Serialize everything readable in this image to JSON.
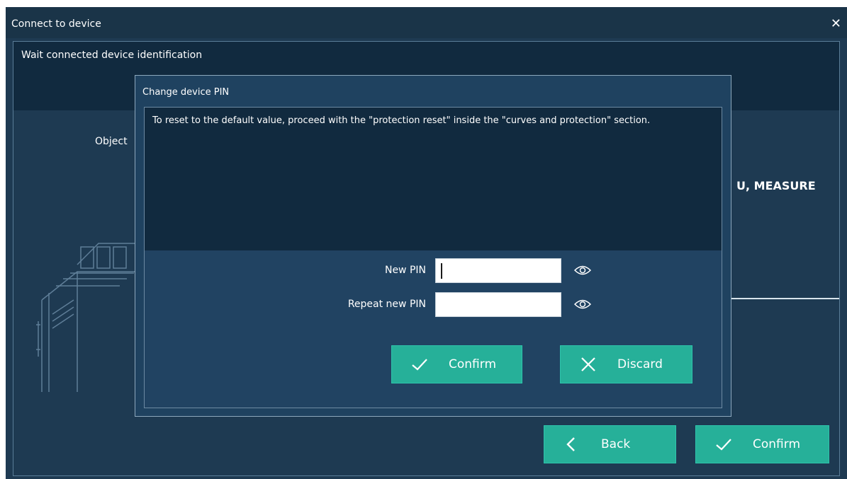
{
  "window": {
    "title": "Connect to device",
    "close_icon": "close-icon"
  },
  "header": {
    "status_text": "Wait connected device  identification"
  },
  "background": {
    "object_label": "Object",
    "right_label": "U, MEASURE",
    "buttons": {
      "back": "Back",
      "confirm": "Confirm"
    }
  },
  "dialog": {
    "title": "Change device PIN",
    "message": "To reset to the default value, proceed with the \"protection reset\" inside the \"curves and protection\" section.",
    "fields": [
      {
        "label": "New PIN",
        "value": "",
        "icon": "eye-icon"
      },
      {
        "label": "Repeat new PIN",
        "value": "",
        "icon": "eye-icon"
      }
    ],
    "buttons": {
      "confirm": "Confirm",
      "discard": "Discard"
    }
  },
  "colors": {
    "window_bg": "#1e3a52",
    "panel_dark": "#112a3f",
    "accent": "#26b099",
    "text": "#ffffff"
  }
}
